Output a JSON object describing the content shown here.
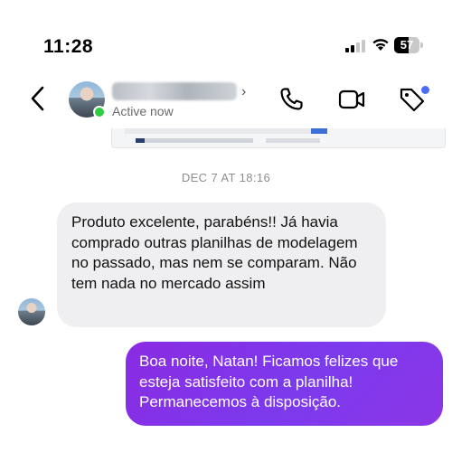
{
  "status_bar": {
    "time": "11:28",
    "battery": "57",
    "battery_level": 0.57
  },
  "header": {
    "back_icon": "chevron-left-icon",
    "contact_chevron": "›",
    "active_status": "Active now",
    "icons": [
      "phone-icon",
      "video-camera-icon",
      "tag-icon"
    ],
    "tag_badge_color": "#4a6cf7",
    "online_color": "#2ecc40"
  },
  "thread": {
    "date_separator": "DEC 7 AT 18:16",
    "messages": [
      {
        "direction": "incoming",
        "text": "Produto excelente, parabéns!! Já havia comprado outras planilhas de modelagem no passado, mas nem se comparam. Não tem nada no mercado assim"
      },
      {
        "direction": "outgoing",
        "text": "Boa noite, Natan! Ficamos felizes que esteja satisfeito com a planilha! Permanecemos à disposição."
      }
    ],
    "outgoing_color": "#7c3aed",
    "incoming_color": "#efeff1"
  }
}
